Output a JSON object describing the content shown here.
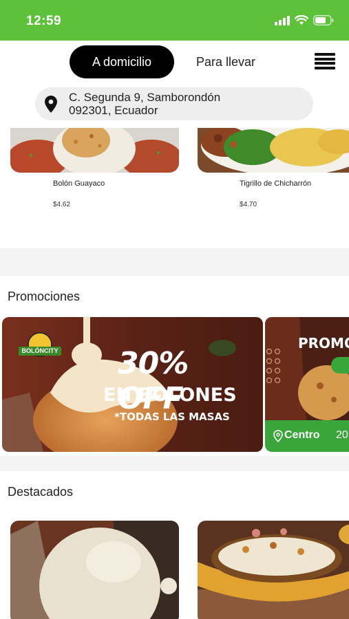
{
  "status_bar": {
    "time": "12:59"
  },
  "header": {
    "tabs": [
      {
        "label": "A domicilio",
        "active": true
      },
      {
        "label": "Para llevar",
        "active": false
      }
    ]
  },
  "address": {
    "line1": "C. Segunda 9, Samborondón",
    "line2": "092301, Ecuador"
  },
  "products": [
    {
      "name": "Bolón Guayaco",
      "price": "$4.62"
    },
    {
      "name": "Tigrillo de Chicharrón",
      "price": "$4.70"
    }
  ],
  "promotions": {
    "title": "Promociones",
    "items": [
      {
        "logo": "BOLÓNCITY",
        "headline": "30% OFF",
        "subheadline": "EN BOLONES",
        "note": "*TODAS LAS MASAS"
      },
      {
        "headline": "PROMO",
        "location": "Centro",
        "extra": "20"
      }
    ]
  },
  "featured": {
    "title": "Destacados"
  },
  "colors": {
    "brand_green": "#5dc13a",
    "active_tab": "#000000"
  }
}
